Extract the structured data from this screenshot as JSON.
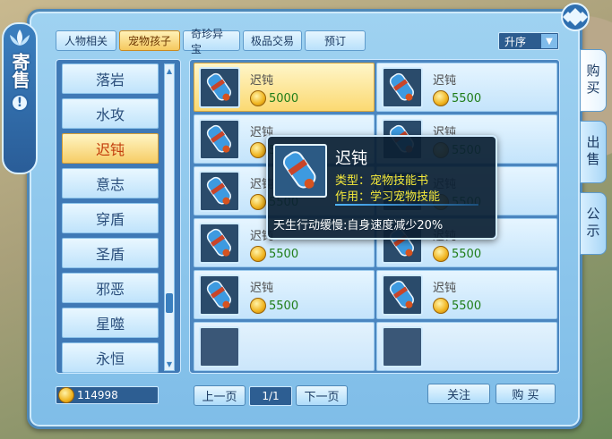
{
  "banner": {
    "title": "寄售",
    "info_glyph": "!"
  },
  "tabs": [
    {
      "label": "人物相关",
      "active": false
    },
    {
      "label": "宠物孩子",
      "active": true
    },
    {
      "label": "奇珍异宝",
      "active": false
    },
    {
      "label": "极品交易",
      "active": false
    },
    {
      "label": "预订",
      "active": false
    }
  ],
  "sort": {
    "value": "升序",
    "icon": "chevron-down-icon"
  },
  "side_tabs": [
    {
      "label": "购买",
      "active": true
    },
    {
      "label": "出售",
      "active": false
    },
    {
      "label": "公示",
      "active": false
    }
  ],
  "categories": [
    {
      "label": "落岩",
      "active": false
    },
    {
      "label": "水攻",
      "active": false
    },
    {
      "label": "迟钝",
      "active": true
    },
    {
      "label": "意志",
      "active": false
    },
    {
      "label": "穿盾",
      "active": false
    },
    {
      "label": "圣盾",
      "active": false
    },
    {
      "label": "邪恶",
      "active": false
    },
    {
      "label": "星噬",
      "active": false
    },
    {
      "label": "永恒",
      "active": false
    }
  ],
  "items": [
    {
      "name": "迟钝",
      "price": "5000",
      "selected": true
    },
    {
      "name": "迟钝",
      "price": "5500",
      "selected": false
    },
    {
      "name": "迟钝",
      "price": "5500",
      "selected": false
    },
    {
      "name": "迟钝",
      "price": "5500",
      "selected": false
    },
    {
      "name": "迟钝",
      "price": "5500",
      "selected": false
    },
    {
      "name": "迟钝",
      "price": "5500",
      "selected": false
    },
    {
      "name": "迟钝",
      "price": "5500",
      "selected": false
    },
    {
      "name": "迟钝",
      "price": "5500",
      "selected": false
    },
    {
      "name": "迟钝",
      "price": "5500",
      "selected": false
    },
    {
      "name": "迟钝",
      "price": "5500",
      "selected": false
    }
  ],
  "tooltip": {
    "name": "迟钝",
    "type_line": "类型：宠物技能书",
    "use_line": "作用：学习宠物技能",
    "description": "天生行动缓慢:自身速度减少20%"
  },
  "footer": {
    "money": "114998",
    "prev_label": "上一页",
    "page": "1/1",
    "next_label": "下一页",
    "follow_label": "关注",
    "buy_label": "购 买"
  },
  "colors": {
    "accent": "#f6cd66",
    "panel": "#3f79b6",
    "price": "#1f7d18",
    "tooltip_highlight": "#f5ea3a"
  }
}
